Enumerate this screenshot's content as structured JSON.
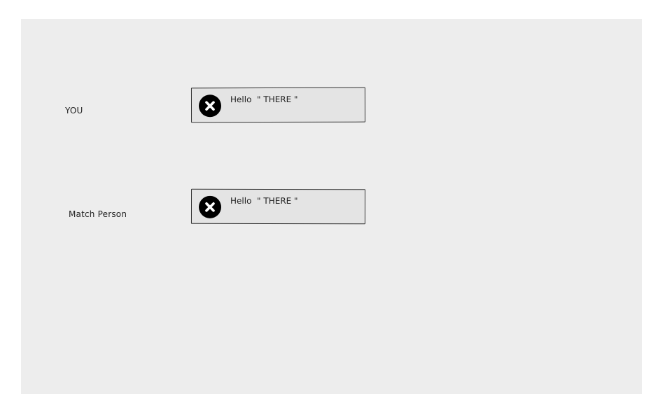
{
  "rows": [
    {
      "label": "YOU",
      "message": "Hello  \" THERE \""
    },
    {
      "label": "Match Person",
      "message": "Hello  \" THERE \""
    }
  ]
}
